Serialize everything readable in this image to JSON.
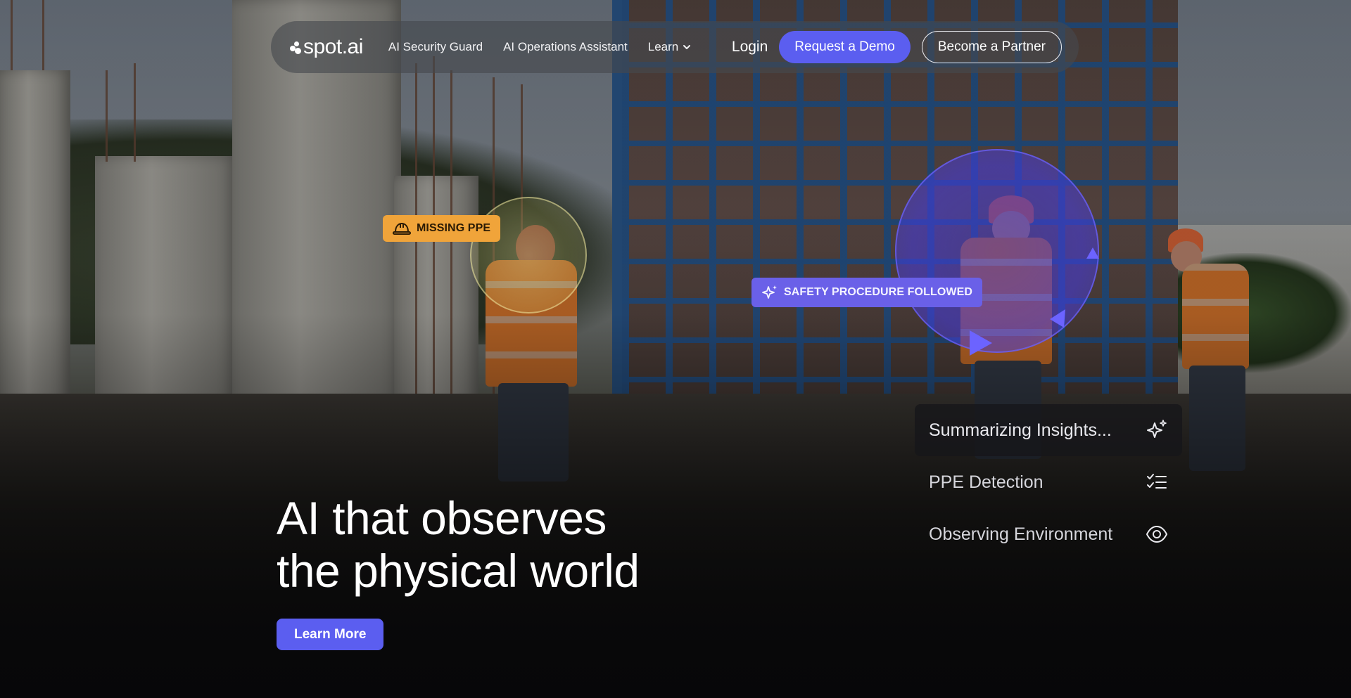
{
  "nav": {
    "logo_text": "spot.ai",
    "links": [
      {
        "label": "AI Security Guard"
      },
      {
        "label": "AI Operations Assistant"
      },
      {
        "label": "Learn"
      }
    ],
    "login_label": "Login",
    "demo_label": "Request a Demo",
    "partner_label": "Become a Partner"
  },
  "detections": {
    "missing_ppe": "MISSING PPE",
    "safety_procedure": "SAFETY PROCEDURE FOLLOWED"
  },
  "status_panel": {
    "items": [
      {
        "label": "Summarizing Insights...",
        "icon": "sparkle-icon"
      },
      {
        "label": "PPE Detection",
        "icon": "checklist-icon"
      },
      {
        "label": "Observing Environment",
        "icon": "eye-icon"
      }
    ]
  },
  "hero": {
    "title_line1": "AI that observes",
    "title_line2": "the physical world",
    "cta_label": "Learn More"
  },
  "colors": {
    "accent": "#5b5ef0",
    "ppe_tag": "#f0a43a",
    "safety_tag": "#6a60e8"
  }
}
